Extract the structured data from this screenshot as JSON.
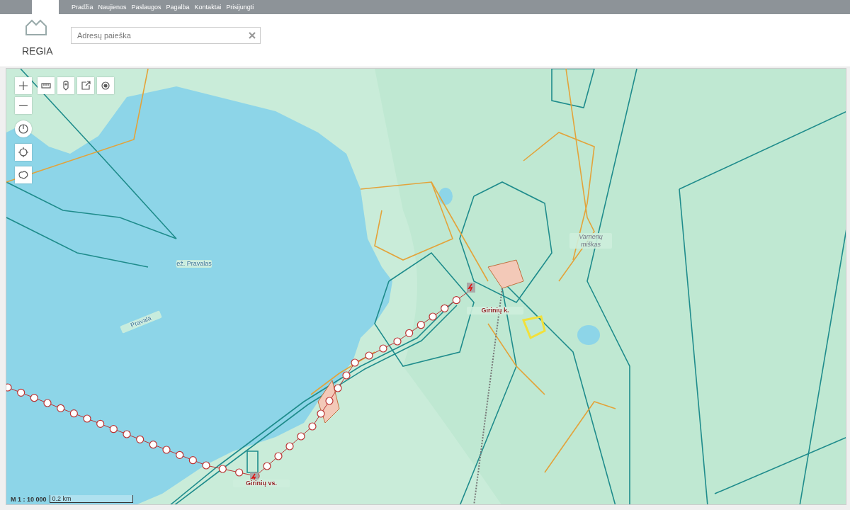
{
  "nav": {
    "links": [
      "Pradžia",
      "Naujienos",
      "Paslaugos",
      "Pagalba",
      "Kontaktai",
      "Prisijungti"
    ]
  },
  "logo": {
    "text": "REGIA"
  },
  "search": {
    "placeholder": "Adresų paieška"
  },
  "map": {
    "labels": [
      {
        "kind": "water",
        "text": "ež. Pravalas"
      },
      {
        "kind": "water",
        "text": "Pravala"
      },
      {
        "kind": "place",
        "text": "Girinių k."
      },
      {
        "kind": "forest",
        "text": "Varnenų miškas"
      },
      {
        "kind": "place",
        "text": "Girinių vs."
      }
    ],
    "scale": {
      "ratio": "M 1 : 10 000",
      "bar": "0.2 km"
    }
  }
}
